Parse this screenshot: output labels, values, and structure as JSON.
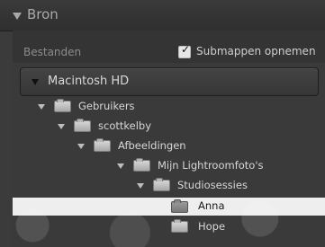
{
  "panel": {
    "title": "Bron",
    "files_label": "Bestanden",
    "include_subfolders_label": "Submappen opnemen",
    "include_subfolders_checked": true
  },
  "tree": {
    "volume": "Macintosh HD",
    "rows": [
      {
        "label": "Gebruikers",
        "expanded": true
      },
      {
        "label": "scottkelby",
        "expanded": true
      },
      {
        "label": "Afbeeldingen",
        "expanded": true
      },
      {
        "label": "Mijn Lightroomfoto's",
        "expanded": true
      },
      {
        "label": "Studiosessies",
        "expanded": true
      },
      {
        "label": "Anna",
        "expanded": false,
        "selected": true
      },
      {
        "label": "Hope",
        "expanded": false
      }
    ]
  }
}
